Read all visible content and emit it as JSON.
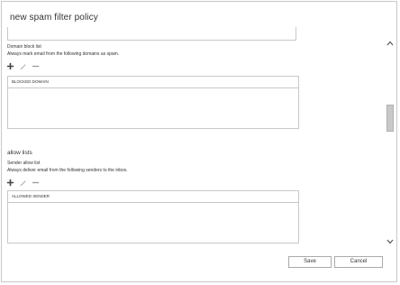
{
  "window": {
    "title": "new spam filter policy"
  },
  "block": {
    "label": "Domain block list",
    "description": "Always mark email from the following domains as spam.",
    "column_header": "BLOCKED DOMAIN"
  },
  "allow": {
    "heading": "allow lists",
    "label": "Sender allow list",
    "description": "Always deliver email from the following senders to the inbox.",
    "column_header": "ALLOWED SENDER"
  },
  "toolbar_icons": [
    "add-icon",
    "edit-icon",
    "remove-icon"
  ],
  "buttons": {
    "save": "Save",
    "cancel": "Cancel"
  },
  "colors": {
    "border": "#c8c8c8",
    "text": "#333333",
    "icon": "#444444",
    "icon_disabled": "#b8b8b8"
  }
}
